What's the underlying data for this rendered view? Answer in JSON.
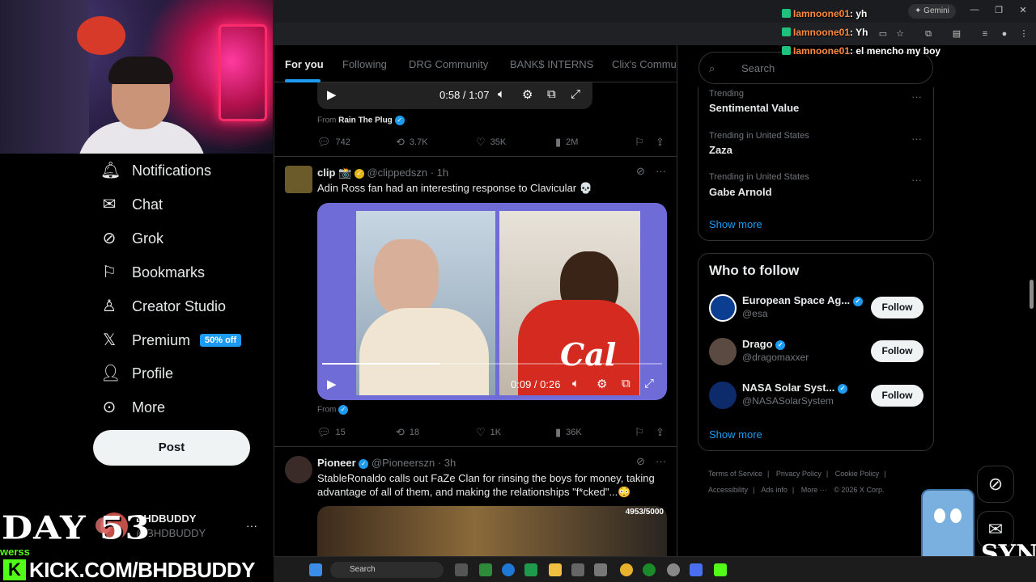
{
  "browser": {
    "gemini_label": "Gemini",
    "min": "—",
    "max": "❐",
    "close": "✕"
  },
  "chat": [
    {
      "user": "Iamnoone01",
      "message": "yh"
    },
    {
      "user": "Iamnoone01",
      "message": "Yh"
    },
    {
      "user": "Iamnoone01",
      "message": "el mencho my boy"
    }
  ],
  "nav": {
    "items": [
      {
        "label": "Notifications",
        "icon": "bell-icon"
      },
      {
        "label": "Chat",
        "icon": "envelope-icon"
      },
      {
        "label": "Grok",
        "icon": "grok-icon"
      },
      {
        "label": "Bookmarks",
        "icon": "bookmark-icon"
      },
      {
        "label": "Creator Studio",
        "icon": "creator-icon"
      },
      {
        "label": "Premium",
        "icon": "x-icon",
        "badge": "50% off"
      },
      {
        "label": "Profile",
        "icon": "person-icon"
      },
      {
        "label": "More",
        "icon": "more-circle-icon"
      }
    ],
    "post_label": "Post",
    "account": {
      "name": "BHDBUDDY",
      "handle": "@BHDBUDDY",
      "more": "···"
    }
  },
  "overlay": {
    "day": "DAY 53",
    "small_green": "werss",
    "kick_url": "KICK.COM/BHDBUDDY"
  },
  "feed": {
    "tabs": [
      "For you",
      "Following",
      "DRG Community",
      "BANK$ INTERNS",
      "Clix's Commu"
    ],
    "post0": {
      "time": "0:58 / 1:07",
      "from_label": "From",
      "from_name": "Rain The Plug",
      "replies": "742",
      "reposts": "3.7K",
      "likes": "35K",
      "views": "2M"
    },
    "post1": {
      "name": "clip",
      "emoji": "📸",
      "handle": "@clippedszn",
      "age": "· 1h",
      "text": "Adin Ross fan had an interesting response to Clavicular 💀",
      "time": "0:09 / 0:26",
      "from_label": "From",
      "replies": "15",
      "reposts": "18",
      "likes": "1K",
      "views": "36K",
      "sweater_text": "Cal"
    },
    "post2": {
      "name": "Pioneer",
      "handle": "@Pioneerszn",
      "age": "· 3h",
      "text": "StableRonaldo calls out FaZe Clan for rinsing the boys for money, taking advantage of all of them, and making the relationships \"f*cked\"...😳",
      "media_count": "4953/5000"
    }
  },
  "right": {
    "search_placeholder": "Search",
    "trends": [
      {
        "meta": "Trending",
        "name": "Sentimental Value"
      },
      {
        "meta": "Trending in United States",
        "name": "Zaza"
      },
      {
        "meta": "Trending in United States",
        "name": "Gabe Arnold"
      }
    ],
    "show_more": "Show more",
    "wtf_title": "Who to follow",
    "follow": [
      {
        "name": "European Space Ag...",
        "handle": "@esa",
        "button": "Follow"
      },
      {
        "name": "Drago",
        "handle": "@dragomaxxer",
        "button": "Follow"
      },
      {
        "name": "NASA Solar Syst...",
        "handle": "@NASASolarSystem",
        "button": "Follow"
      }
    ],
    "wtf_show_more": "Show more",
    "footer": [
      "Terms of Service",
      "|",
      "Privacy Policy",
      "|",
      "Cookie Policy",
      "|",
      "Accessibility",
      "|",
      "Ads info",
      "|",
      "More ···",
      "© 2026 X Corp."
    ]
  },
  "taskbar": {
    "search_label": "Search"
  },
  "colors": {
    "accent": "#1d9bf0",
    "kick_green": "#53fc18",
    "background": "#000000"
  }
}
